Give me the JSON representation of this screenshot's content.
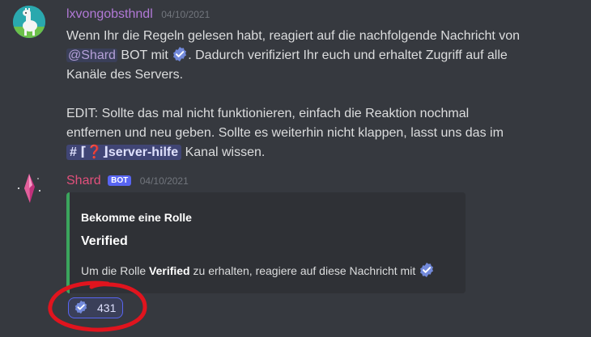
{
  "colors": {
    "background": "#36393f",
    "accent": "#5865f2",
    "embed_bar": "#3ba55d",
    "annotation": "#e0141e"
  },
  "messages": [
    {
      "author": "lxvongobsthndl",
      "timestamp": "04/10/2021",
      "avatar_icon": "llama-icon",
      "line1": "Wenn Ihr die Regeln gelesen habt, reagiert auf die nachfolgende Nachricht von",
      "mention": "@Shard",
      "line2a": "BOT mit",
      "line2b": ". Dadurch verifiziert Ihr euch und erhaltet Zugriff auf alle",
      "line3": "Kanäle des Servers.",
      "line4": "EDIT: Sollte das mal nicht funktionieren, einfach die Reaktion nochmal",
      "line5": "entfernen und neu geben. Sollte es weiterhin nicht klappen, lasst uns das im",
      "channel": "# ⌈❓⌋server-hilfe",
      "line6": "Kanal wissen."
    },
    {
      "author": "Shard",
      "bot_badge": "BOT",
      "timestamp": "04/10/2021",
      "avatar_icon": "crystal-icon",
      "embed": {
        "author": "Bekomme eine Rolle",
        "title": "Verified",
        "desc_prefix": "Um die Rolle",
        "desc_bold": "Verified",
        "desc_suffix": "zu erhalten, reagiere auf diese Nachricht mit"
      },
      "reaction": {
        "emoji": "verified-icon",
        "count": "431"
      }
    }
  ]
}
